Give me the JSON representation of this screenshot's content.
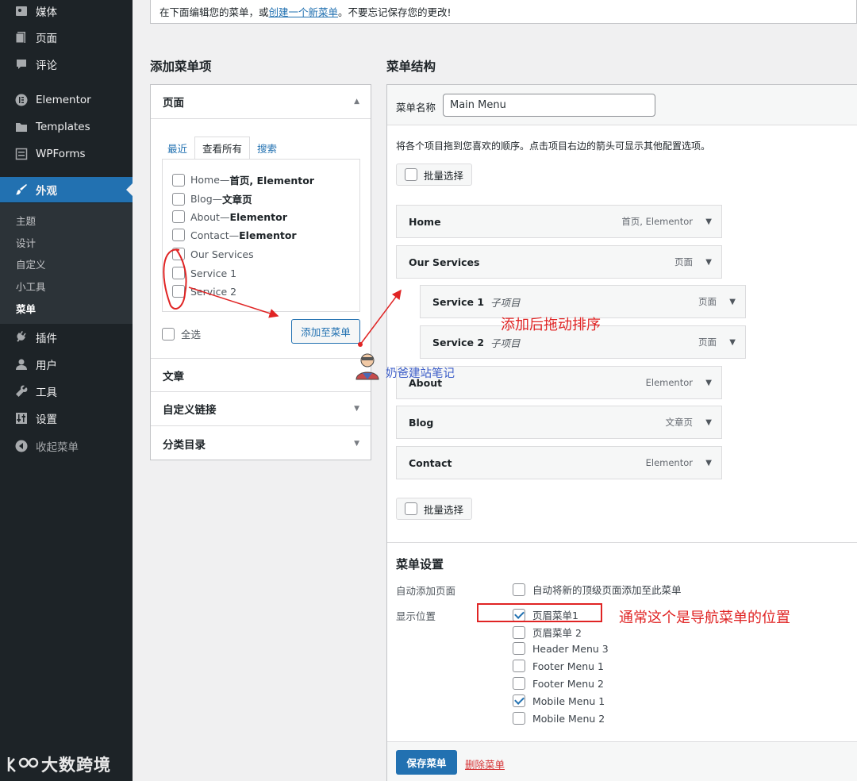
{
  "sidebar": {
    "items": [
      {
        "label": "媒体",
        "icon": "media-icon"
      },
      {
        "label": "页面",
        "icon": "page-icon"
      },
      {
        "label": "评论",
        "icon": "comment-icon"
      },
      {
        "label": "Elementor",
        "icon": "elementor-icon"
      },
      {
        "label": "Templates",
        "icon": "folder-icon"
      },
      {
        "label": "WPForms",
        "icon": "forms-icon"
      },
      {
        "label": "外观",
        "icon": "brush-icon"
      },
      {
        "label": "插件",
        "icon": "plugin-icon"
      },
      {
        "label": "用户",
        "icon": "user-icon"
      },
      {
        "label": "工具",
        "icon": "wrench-icon"
      },
      {
        "label": "设置",
        "icon": "settings-icon"
      },
      {
        "label": "收起菜单",
        "icon": "collapse-icon"
      }
    ],
    "submenu": [
      "主题",
      "设计",
      "自定义",
      "小工具",
      "菜单"
    ]
  },
  "notice": {
    "before": "在下面编辑您的菜单，或",
    "link": "创建一个新菜单",
    "after": "。不要忘记保存您的更改!"
  },
  "add_items": {
    "title": "添加菜单项",
    "pages_header": "页面",
    "tabs": [
      "最近",
      "查看所有",
      "搜索"
    ],
    "pages": [
      {
        "name": "Home",
        "sep": " — ",
        "tag": "首页, Elementor"
      },
      {
        "name": "Blog",
        "sep": " — ",
        "tag": "文章页"
      },
      {
        "name": "About",
        "sep": " — ",
        "tag": "Elementor"
      },
      {
        "name": "Contact",
        "sep": " — ",
        "tag": "Elementor"
      },
      {
        "name": "Our Services",
        "sep": "",
        "tag": ""
      },
      {
        "name": "Service 1",
        "sep": "",
        "tag": ""
      },
      {
        "name": "Service 2",
        "sep": "",
        "tag": ""
      }
    ],
    "select_all": "全选",
    "add_button": "添加至菜单",
    "sections": [
      "文章",
      "自定义链接",
      "分类目录"
    ]
  },
  "structure": {
    "title": "菜单结构",
    "name_label": "菜单名称",
    "name_value": "Main Menu",
    "hint": "将各个项目拖到您喜欢的顺序。点击项目右边的箭头可显示其他配置选项。",
    "bulk_select": "批量选择",
    "items": [
      {
        "title": "Home",
        "sub": "",
        "type": "首页, Elementor",
        "depth": 0
      },
      {
        "title": "Our Services",
        "sub": "",
        "type": "页面",
        "depth": 0
      },
      {
        "title": "Service 1",
        "sub": "子项目",
        "type": "页面",
        "depth": 1
      },
      {
        "title": "Service 2",
        "sub": "子项目",
        "type": "页面",
        "depth": 1
      },
      {
        "title": "About",
        "sub": "",
        "type": "Elementor",
        "depth": 0
      },
      {
        "title": "Blog",
        "sub": "",
        "type": "文章页",
        "depth": 0
      },
      {
        "title": "Contact",
        "sub": "",
        "type": "Elementor",
        "depth": 0
      }
    ]
  },
  "settings": {
    "title": "菜单设置",
    "auto_add_label": "自动添加页面",
    "auto_add_option": "自动将新的顶级页面添加至此菜单",
    "location_label": "显示位置",
    "locations": [
      {
        "label": "页眉菜单1",
        "checked": true
      },
      {
        "label": "页眉菜单 2",
        "checked": false
      },
      {
        "label": "Header Menu 3",
        "checked": false
      },
      {
        "label": "Footer Menu 1",
        "checked": false
      },
      {
        "label": "Footer Menu 2",
        "checked": false
      },
      {
        "label": "Mobile Menu 1",
        "checked": true
      },
      {
        "label": "Mobile Menu 2",
        "checked": false
      }
    ]
  },
  "actions": {
    "save": "保存菜单",
    "delete": "删除菜单"
  },
  "annotations": {
    "drag_note": "添加后拖动排序",
    "location_note": "通常这个是导航菜单的位置",
    "watermark": "奶爸建站笔记",
    "corner_logo": "大数跨境"
  },
  "colors": {
    "accent": "#2271b1",
    "sidebar": "#1d2327",
    "annotation": "#e02424",
    "danger": "#d63638"
  }
}
